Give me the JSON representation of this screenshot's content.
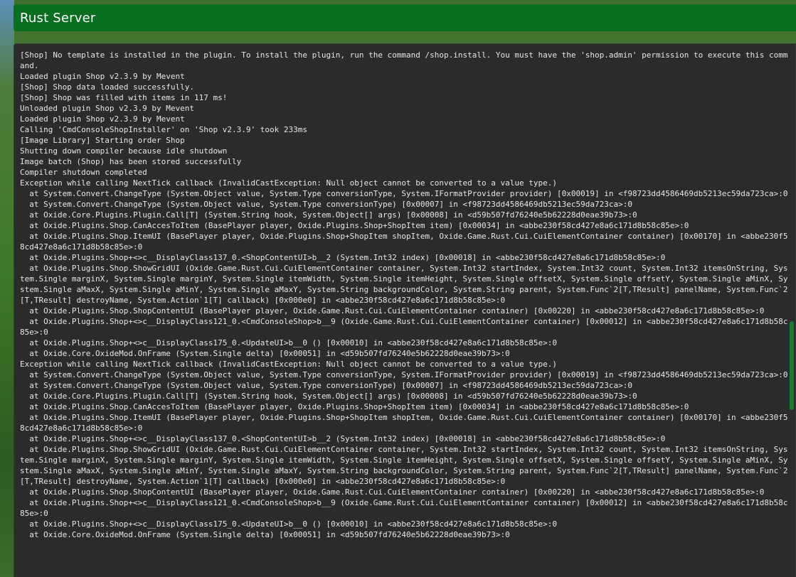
{
  "window": {
    "title": "Rust Server"
  },
  "console": {
    "lines": [
      "[Shop] No template is installed in the plugin. To install the plugin, run the command /shop.install. You must have the 'shop.admin' permission to execute this command.",
      "Loaded plugin Shop v2.3.9 by Mevent",
      "[Shop] Shop data loaded successfully.",
      "[Shop] Shop was filled with items in 117 ms!",
      "Unloaded plugin Shop v2.3.9 by Mevent",
      "Loaded plugin Shop v2.3.9 by Mevent",
      "Calling 'CmdConsoleShopInstaller' on 'Shop v2.3.9' took 233ms",
      "[Image Library] Starting order Shop",
      "Shutting down compiler because idle shutdown",
      "Image batch (Shop) has been stored successfully",
      "Compiler shutdown completed",
      "Exception while calling NextTick callback (InvalidCastException: Null object cannot be converted to a value type.)",
      "  at System.Convert.ChangeType (System.Object value, System.Type conversionType, System.IFormatProvider provider) [0x00019] in <f98723dd4586469db5213ec59da723ca>:0",
      "  at System.Convert.ChangeType (System.Object value, System.Type conversionType) [0x00007] in <f98723dd4586469db5213ec59da723ca>:0",
      "  at Oxide.Core.Plugins.Plugin.Call[T] (System.String hook, System.Object[] args) [0x00008] in <d59b507fd76240e5b62228d0eae39b73>:0",
      "  at Oxide.Plugins.Shop.CanAccesToItem (BasePlayer player, Oxide.Plugins.Shop+ShopItem item) [0x00034] in <abbe230f58cd427e8a6c171d8b58c85e>:0",
      "  at Oxide.Plugins.Shop.ItemUI (BasePlayer player, Oxide.Plugins.Shop+ShopItem shopItem, Oxide.Game.Rust.Cui.CuiElementContainer container) [0x00170] in <abbe230f58cd427e8a6c171d8b58c85e>:0",
      "  at Oxide.Plugins.Shop+<>c__DisplayClass137_0.<ShopContentUI>b__2 (System.Int32 index) [0x00018] in <abbe230f58cd427e8a6c171d8b58c85e>:0",
      "  at Oxide.Plugins.Shop.ShowGridUI (Oxide.Game.Rust.Cui.CuiElementContainer container, System.Int32 startIndex, System.Int32 count, System.Int32 itemsOnString, System.Single marginX, System.Single marginY, System.Single itemWidth, System.Single itemHeight, System.Single offsetX, System.Single offsetY, System.Single aMinX, System.Single aMaxX, System.Single aMinY, System.Single aMaxY, System.String backgroundColor, System.String parent, System.Func`2[T,TResult] panelName, System.Func`2[T,TResult] destroyName, System.Action`1[T] callback) [0x000e0] in <abbe230f58cd427e8a6c171d8b58c85e>:0",
      "  at Oxide.Plugins.Shop.ShopContentUI (BasePlayer player, Oxide.Game.Rust.Cui.CuiElementContainer container) [0x00220] in <abbe230f58cd427e8a6c171d8b58c85e>:0",
      "  at Oxide.Plugins.Shop+<>c__DisplayClass121_0.<CmdConsoleShop>b__9 (Oxide.Game.Rust.Cui.CuiElementContainer container) [0x00012] in <abbe230f58cd427e8a6c171d8b58c85e>:0",
      "  at Oxide.Plugins.Shop+<>c__DisplayClass175_0.<UpdateUI>b__0 () [0x00010] in <abbe230f58cd427e8a6c171d8b58c85e>:0",
      "  at Oxide.Core.OxideMod.OnFrame (System.Single delta) [0x00051] in <d59b507fd76240e5b62228d0eae39b73>:0",
      "Exception while calling NextTick callback (InvalidCastException: Null object cannot be converted to a value type.)",
      "  at System.Convert.ChangeType (System.Object value, System.Type conversionType, System.IFormatProvider provider) [0x00019] in <f98723dd4586469db5213ec59da723ca>:0",
      "  at System.Convert.ChangeType (System.Object value, System.Type conversionType) [0x00007] in <f98723dd4586469db5213ec59da723ca>:0",
      "  at Oxide.Core.Plugins.Plugin.Call[T] (System.String hook, System.Object[] args) [0x00008] in <d59b507fd76240e5b62228d0eae39b73>:0",
      "  at Oxide.Plugins.Shop.CanAccesToItem (BasePlayer player, Oxide.Plugins.Shop+ShopItem item) [0x00034] in <abbe230f58cd427e8a6c171d8b58c85e>:0",
      "  at Oxide.Plugins.Shop.ItemUI (BasePlayer player, Oxide.Plugins.Shop+ShopItem shopItem, Oxide.Game.Rust.Cui.CuiElementContainer container) [0x00170] in <abbe230f58cd427e8a6c171d8b58c85e>:0",
      "  at Oxide.Plugins.Shop+<>c__DisplayClass137_0.<ShopContentUI>b__2 (System.Int32 index) [0x00018] in <abbe230f58cd427e8a6c171d8b58c85e>:0",
      "  at Oxide.Plugins.Shop.ShowGridUI (Oxide.Game.Rust.Cui.CuiElementContainer container, System.Int32 startIndex, System.Int32 count, System.Int32 itemsOnString, System.Single marginX, System.Single marginY, System.Single itemWidth, System.Single itemHeight, System.Single offsetX, System.Single offsetY, System.Single aMinX, System.Single aMaxX, System.Single aMinY, System.Single aMaxY, System.String backgroundColor, System.String parent, System.Func`2[T,TResult] panelName, System.Func`2[T,TResult] destroyName, System.Action`1[T] callback) [0x000e0] in <abbe230f58cd427e8a6c171d8b58c85e>:0",
      "  at Oxide.Plugins.Shop.ShopContentUI (BasePlayer player, Oxide.Game.Rust.Cui.CuiElementContainer container) [0x00220] in <abbe230f58cd427e8a6c171d8b58c85e>:0",
      "  at Oxide.Plugins.Shop+<>c__DisplayClass121_0.<CmdConsoleShop>b__9 (Oxide.Game.Rust.Cui.CuiElementContainer container) [0x00012] in <abbe230f58cd427e8a6c171d8b58c85e>:0",
      "  at Oxide.Plugins.Shop+<>c__DisplayClass175_0.<UpdateUI>b__0 () [0x00010] in <abbe230f58cd427e8a6c171d8b58c85e>:0",
      "  at Oxide.Core.OxideMod.OnFrame (System.Single delta) [0x00051] in <d59b507fd76240e5b62228d0eae39b73>:0"
    ]
  },
  "colors": {
    "title_bar": "#0a6e20",
    "console_bg": "#2b2b2b",
    "console_text": "#e6e6e6",
    "scrollbar": "#1e7a2e"
  }
}
